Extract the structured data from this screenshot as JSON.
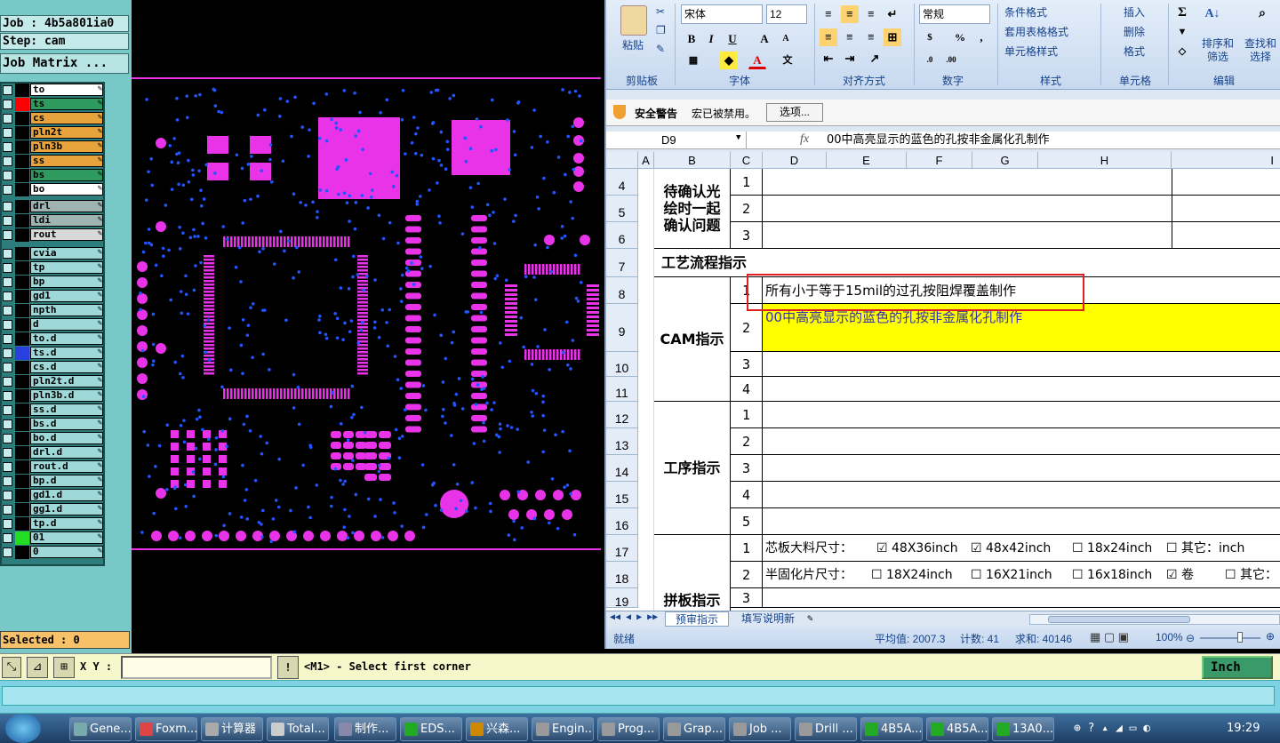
{
  "genesis": {
    "job": "Job : 4b5a801ia0",
    "step": "Step: cam",
    "job_matrix": "Job Matrix ...",
    "layers": [
      {
        "name": "to",
        "color": "#ffffff",
        "sw": "#000000"
      },
      {
        "name": "ts",
        "color": "#2e9a5e",
        "sw": "#ff0000"
      },
      {
        "name": "cs",
        "color": "#e8a33c",
        "sw": "#000000"
      },
      {
        "name": "pln2t",
        "color": "#e8a33c",
        "sw": "#000000"
      },
      {
        "name": "pln3b",
        "color": "#e8a33c",
        "sw": "#000000"
      },
      {
        "name": "ss",
        "color": "#e8a33c",
        "sw": "#000000"
      },
      {
        "name": "bs",
        "color": "#2e9a5e",
        "sw": "#000000"
      },
      {
        "name": "bo",
        "color": "#ffffff",
        "sw": "#000000"
      },
      {
        "name": "drl",
        "color": "#9fb3b3",
        "sw": "#000000"
      },
      {
        "name": "ldi",
        "color": "#9fb3b3",
        "sw": "#000000"
      },
      {
        "name": "rout",
        "color": "#d8d8d8",
        "sw": "#000000"
      },
      {
        "name": "cvia",
        "color": "#9ed8d8",
        "sw": "#000000"
      },
      {
        "name": "tp",
        "color": "#9ed8d8",
        "sw": "#000000"
      },
      {
        "name": "bp",
        "color": "#9ed8d8",
        "sw": "#000000"
      },
      {
        "name": "gd1",
        "color": "#9ed8d8",
        "sw": "#000000"
      },
      {
        "name": "npth",
        "color": "#9ed8d8",
        "sw": "#000000"
      },
      {
        "name": "d",
        "color": "#9ed8d8",
        "sw": "#000000"
      },
      {
        "name": "to.d",
        "color": "#9ed8d8",
        "sw": "#000000"
      },
      {
        "name": "ts.d",
        "color": "#9ed8d8",
        "sw": "#2a3fe0"
      },
      {
        "name": "cs.d",
        "color": "#9ed8d8",
        "sw": "#000000"
      },
      {
        "name": "pln2t.d",
        "color": "#9ed8d8",
        "sw": "#000000"
      },
      {
        "name": "pln3b.d",
        "color": "#9ed8d8",
        "sw": "#000000"
      },
      {
        "name": "ss.d",
        "color": "#9ed8d8",
        "sw": "#000000"
      },
      {
        "name": "bs.d",
        "color": "#9ed8d8",
        "sw": "#000000"
      },
      {
        "name": "bo.d",
        "color": "#9ed8d8",
        "sw": "#000000"
      },
      {
        "name": "drl.d",
        "color": "#9ed8d8",
        "sw": "#000000"
      },
      {
        "name": "rout.d",
        "color": "#9ed8d8",
        "sw": "#000000"
      },
      {
        "name": "bp.d",
        "color": "#9ed8d8",
        "sw": "#000000"
      },
      {
        "name": "gd1.d",
        "color": "#9ed8d8",
        "sw": "#000000"
      },
      {
        "name": "gg1.d",
        "color": "#9ed8d8",
        "sw": "#000000"
      },
      {
        "name": "tp.d",
        "color": "#9ed8d8",
        "sw": "#000000"
      },
      {
        "name": "01",
        "color": "#9ed8d8",
        "sw": "#22dd22"
      },
      {
        "name": "0",
        "color": "#9ed8d8",
        "sw": "#000000"
      }
    ],
    "selected": "Selected : 0",
    "xy_label": "X Y :",
    "prompt": "<M1> - Select first corner",
    "units": "Inch"
  },
  "excel": {
    "ribbon": {
      "paste": "粘贴",
      "font_name": "宋体",
      "font_size": "12",
      "number_format": "常规",
      "cond_format": "条件格式",
      "table_format": "套用表格格式",
      "cell_style": "单元格样式",
      "insert": "插入",
      "delete": "删除",
      "format": "格式",
      "sort": "排序和\n筛选",
      "find": "查找和\n选择",
      "groups": [
        "剪贴板",
        "字体",
        "对齐方式",
        "数字",
        "样式",
        "单元格",
        "编辑"
      ]
    },
    "security": {
      "title": "安全警告",
      "msg": "宏已被禁用。",
      "button": "选项..."
    },
    "namebox": "D9",
    "formula": "00中高亮显示的蓝色的孔按非金属化孔制作",
    "columns": [
      "A",
      "B",
      "C",
      "D",
      "E",
      "F",
      "G",
      "H",
      "I"
    ],
    "rows": [
      "4",
      "5",
      "6",
      "7",
      "8",
      "9",
      "10",
      "11",
      "12",
      "13",
      "14",
      "15",
      "16",
      "17",
      "18",
      "19"
    ],
    "sections": {
      "pending": "待确认光\n绘时一起\n确认问题",
      "process": "工艺流程指示",
      "cam": "CAM指示",
      "procedure": "工序指示",
      "panel": "拼板指示"
    },
    "cells": {
      "c8": "所有小于等于15mil的过孔按阻焊覆盖制作",
      "c9": "00中高亮显示的蓝色的孔按非金属化孔制作",
      "r17": "芯板大料尺寸：",
      "r17_opts": [
        "48X36inch",
        "48x42inch",
        "18x24inch",
        "其它：inch"
      ],
      "r18": "半固化片尺寸：",
      "r18_opts": [
        "18X24inch",
        "16X21inch",
        "16x18inch",
        "卷",
        "其它："
      ]
    },
    "sheets": [
      "预审指示",
      "填写说明新"
    ],
    "status": {
      "ready": "就绪",
      "avg": "平均值: 2007.3",
      "count": "计数: 41",
      "sum": "求和: 40146",
      "zoom": "100%"
    }
  },
  "taskbar": {
    "items": [
      "Gene...",
      "Foxm...",
      "计算器",
      "Total...",
      "制作...",
      "EDS...",
      "兴森...",
      "Engin...",
      "Prog...",
      "Grap...",
      "Job ...",
      "Drill ...",
      "4B5A...",
      "4B5A...",
      "13A0..."
    ],
    "time": "19:29"
  }
}
